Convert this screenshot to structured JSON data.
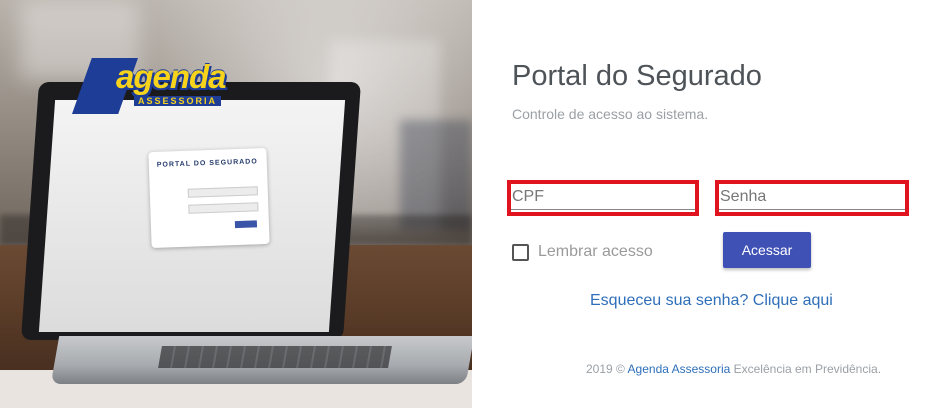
{
  "hero": {
    "logo_word": "agenda",
    "logo_sub": "ASSESSORIA",
    "mini_title": "PORTAL DO SEGURADO",
    "image_icon": "laptop-icon"
  },
  "login": {
    "title": "Portal do Segurado",
    "subtitle": "Controle de acesso ao sistema.",
    "cpf_placeholder": "CPF",
    "cpf_value": "",
    "password_placeholder": "Senha",
    "password_value": "",
    "remember_label": "Lembrar acesso",
    "remember_checked": false,
    "submit_label": "Acessar",
    "forgot_link": "Esqueceu sua senha? Clique aqui"
  },
  "footer": {
    "prefix": "2019 ©",
    "company": "Agenda Assessoria",
    "tagline": "Excelência em Previdência."
  },
  "colors": {
    "accent": "#3f51b5",
    "link": "#2f6fba",
    "highlight_border": "#e0141e",
    "logo_blue": "#1e3d97",
    "logo_yellow": "#f7d41b"
  }
}
